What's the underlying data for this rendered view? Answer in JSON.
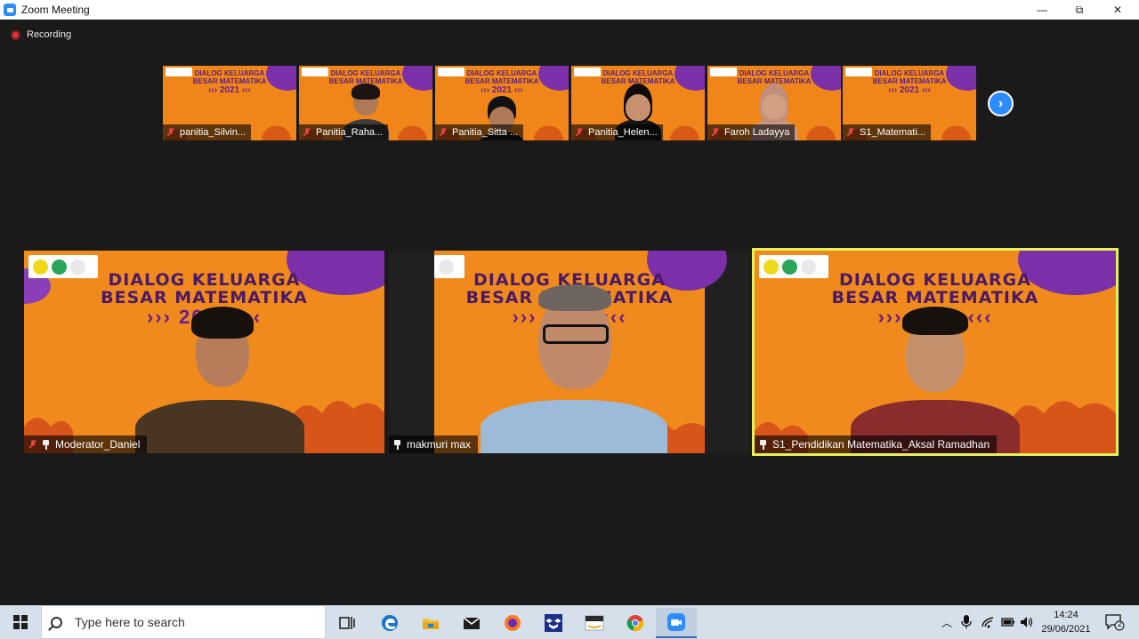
{
  "window": {
    "title": "Zoom Meeting",
    "controls": {
      "minimize": "—",
      "restore": "⧉",
      "close": "✕"
    }
  },
  "meeting": {
    "recording_label": "Recording",
    "background": {
      "line1": "DIALOG KELUARGA",
      "line2": "BESAR MATEMATIKA",
      "year_line": "››› 2021 ‹‹‹"
    },
    "thumbnails": [
      {
        "name": "panitia_Silvin...",
        "muted": true,
        "video": "background-only"
      },
      {
        "name": "Panitia_Raha...",
        "muted": true,
        "video": "person"
      },
      {
        "name": "Panitia_Sitta ...",
        "muted": true,
        "video": "person"
      },
      {
        "name": "Panitia_Helen...",
        "muted": true,
        "video": "person"
      },
      {
        "name": "Faroh Ladayya",
        "muted": true,
        "video": "person"
      },
      {
        "name": "S1_Matemati...",
        "muted": true,
        "video": "background-only"
      }
    ],
    "next_page_icon": "chevron-right-icon",
    "tiles": [
      {
        "name": "Moderator_Daniel",
        "muted": true,
        "pinned": true,
        "active_speaker": false
      },
      {
        "name": "makmuri max",
        "muted": false,
        "pinned": true,
        "active_speaker": false
      },
      {
        "name": "S1_Pendidikan Matematika_Aksal Ramadhan",
        "muted": false,
        "pinned": true,
        "active_speaker": true
      }
    ],
    "colors": {
      "background_orange": "#f18a1c",
      "accent_purple": "#7b2fa8",
      "active_speaker_border": "#e6f05a",
      "zoom_blue": "#2d8cff"
    }
  },
  "taskbar": {
    "search_placeholder": "Type here to search",
    "apps": [
      "task-view-icon",
      "edge-icon",
      "file-explorer-icon",
      "mail-icon",
      "firefox-icon",
      "dropbox-icon",
      "amazon-icon",
      "chrome-icon",
      "zoom-icon"
    ],
    "tray": {
      "notification_count": "2",
      "time": "14:24",
      "date": "29/06/2021"
    }
  }
}
